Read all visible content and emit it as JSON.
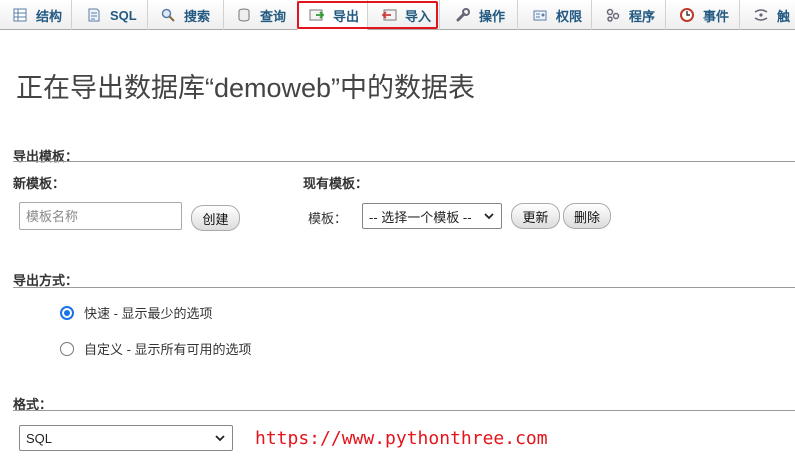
{
  "tabs": [
    {
      "label": "结构",
      "icon": "structure-icon",
      "active": false
    },
    {
      "label": "SQL",
      "icon": "sql-icon",
      "active": false
    },
    {
      "label": "搜索",
      "icon": "search-icon",
      "active": false
    },
    {
      "label": "查询",
      "icon": "query-icon",
      "active": false
    },
    {
      "label": "导出",
      "icon": "export-icon",
      "active": true
    },
    {
      "label": "导入",
      "icon": "import-icon",
      "active": false
    },
    {
      "label": "操作",
      "icon": "wrench-icon",
      "active": false
    },
    {
      "label": "权限",
      "icon": "privileges-icon",
      "active": false
    },
    {
      "label": "程序",
      "icon": "routines-icon",
      "active": false
    },
    {
      "label": "事件",
      "icon": "clock-icon",
      "active": false
    },
    {
      "label": "触",
      "icon": "triggers-icon",
      "active": false
    }
  ],
  "highlight_color": "#e3141b",
  "accent_color": "#235a81",
  "page": {
    "title": "正在导出数据库“demoweb”中的数据表"
  },
  "template_section": {
    "title": "导出模板：",
    "new_template": {
      "title": "新模板：",
      "input_placeholder": "模板名称",
      "create_button": "创建"
    },
    "existing_template": {
      "title": "现有模板：",
      "label": "模板：",
      "select_value": "-- 选择一个模板 --",
      "update_button": "更新",
      "delete_button": "删除"
    }
  },
  "method_section": {
    "title": "导出方式：",
    "options": [
      {
        "label": "快速 - 显示最少的选项",
        "checked": true
      },
      {
        "label": "自定义 - 显示所有可用的选项",
        "checked": false
      }
    ]
  },
  "format_section": {
    "title": "格式：",
    "select_value": "SQL"
  },
  "watermark": "https://www.pythonthree.com"
}
